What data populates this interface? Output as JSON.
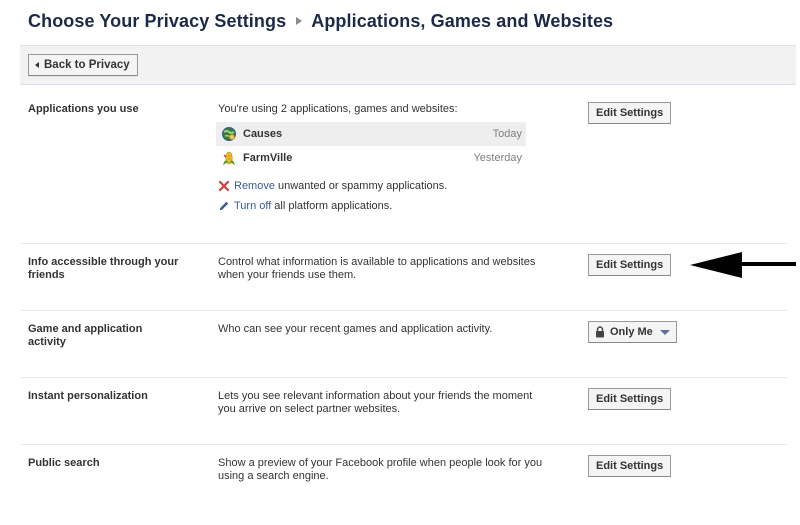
{
  "header": {
    "crumb_root": "Choose Your Privacy Settings",
    "crumb_current": "Applications, Games and Websites"
  },
  "toolbar": {
    "back_label": "Back to Privacy"
  },
  "sections": {
    "apps_used": {
      "label": "Applications you use",
      "description": "You're using 2 applications, games and websites:",
      "apps": [
        {
          "name": "Causes",
          "time": "Today",
          "icon": "causes-icon"
        },
        {
          "name": "FarmVille",
          "time": "Yesterday",
          "icon": "farmville-icon"
        }
      ],
      "remove_link": "Remove",
      "remove_text": "unwanted or spammy applications.",
      "turnoff_link": "Turn off",
      "turnoff_text": "all platform applications.",
      "button": "Edit Settings"
    },
    "friends_info": {
      "label": "Info accessible through your friends",
      "description": "Control what information is available to applications and websites when your friends use them.",
      "button": "Edit Settings"
    },
    "activity": {
      "label": "Game and application activity",
      "description": "Who can see your recent games and application activity.",
      "dropdown_value": "Only Me"
    },
    "personalization": {
      "label": "Instant personalization",
      "description": "Lets you see relevant information about your friends the moment you arrive on select partner websites.",
      "button": "Edit Settings"
    },
    "public_search": {
      "label": "Public search",
      "description": "Show a preview of your Facebook profile when people look for you using a search engine.",
      "button": "Edit Settings"
    }
  },
  "colors": {
    "title": "#1c2a47",
    "link": "#3b5998",
    "muted": "#808080",
    "toolbar_bg": "#f2f2f2"
  }
}
